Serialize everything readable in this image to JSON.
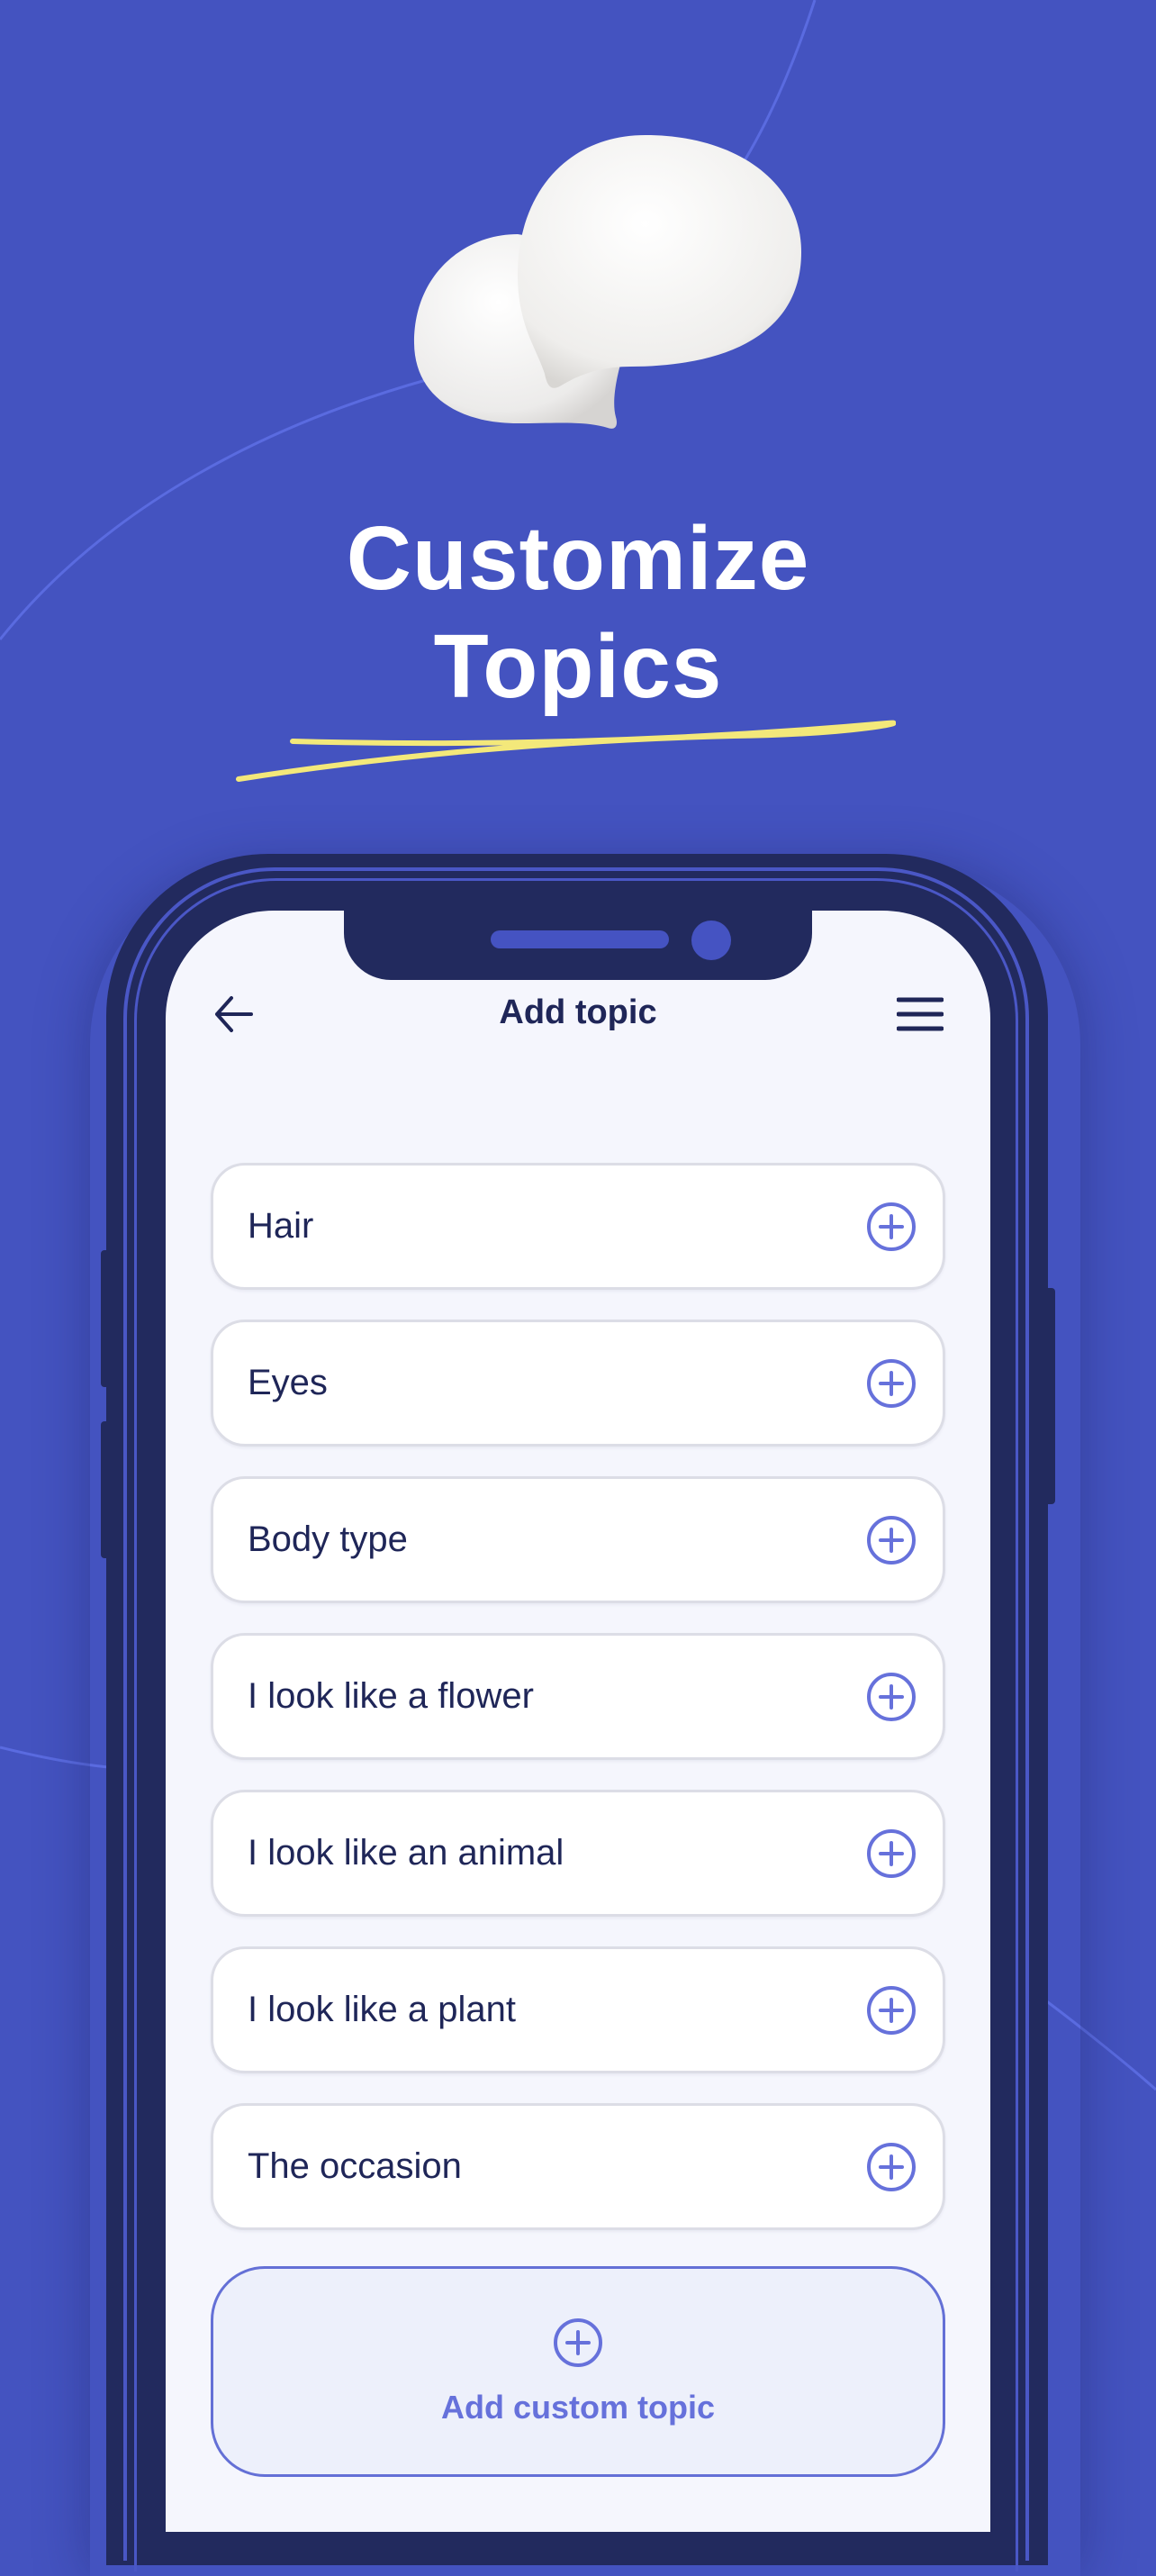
{
  "hero": {
    "headline_line1": "Customize",
    "headline_line2": "Topics",
    "illustration": "speech-bubbles-icon"
  },
  "colors": {
    "background": "#4453c0",
    "phone_frame": "#222a5e",
    "accent": "#6671db",
    "underline": "#f3e87a",
    "text_dark": "#1f2658"
  },
  "app": {
    "nav": {
      "title": "Add topic",
      "back_icon": "arrow-left-icon",
      "menu_icon": "hamburger-menu-icon"
    },
    "topics": [
      {
        "label": "Hair"
      },
      {
        "label": "Eyes"
      },
      {
        "label": "Body type"
      },
      {
        "label": "I look like a flower"
      },
      {
        "label": "I look like an animal"
      },
      {
        "label": "I look like a plant"
      },
      {
        "label": "The occasion"
      }
    ],
    "custom_button": {
      "label": "Add custom topic",
      "icon": "plus-circle-icon"
    }
  }
}
